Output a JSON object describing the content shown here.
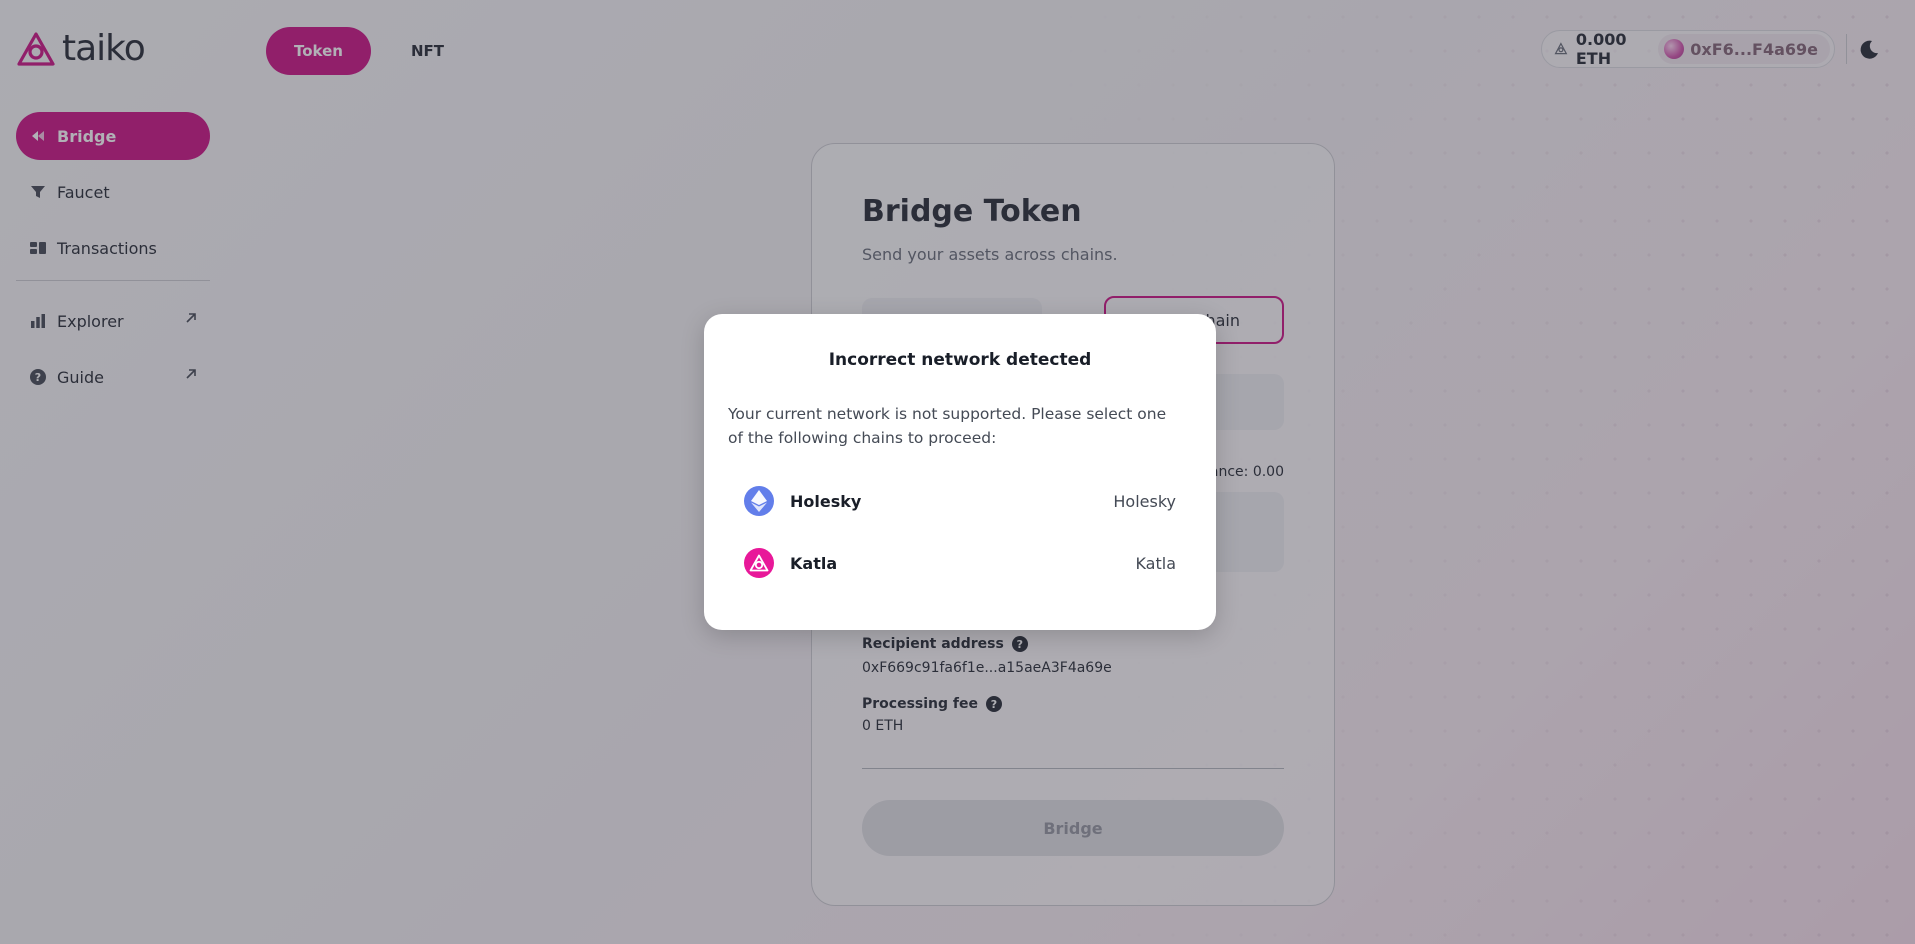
{
  "app": {
    "logo_text": "taiko"
  },
  "top_tabs": [
    {
      "label": "Token",
      "active": true
    },
    {
      "label": "NFT",
      "active": false
    }
  ],
  "sidebar": {
    "items": [
      {
        "label": "Bridge",
        "icon": "bridge-icon",
        "active": true
      },
      {
        "label": "Faucet",
        "icon": "faucet-icon",
        "active": false
      },
      {
        "label": "Transactions",
        "icon": "transactions-icon",
        "active": false
      }
    ],
    "external": [
      {
        "label": "Explorer",
        "icon": "chart-icon"
      },
      {
        "label": "Guide",
        "icon": "question-icon"
      }
    ]
  },
  "wallet": {
    "balance": "0.000 ETH",
    "address": "0xF6...F4a69e"
  },
  "bridge_card": {
    "title": "Bridge Token",
    "subtitle": "Send your assets across chains.",
    "to_chain_visible": "hain",
    "balance_label": "ance: 0.00",
    "recipient_label": "Recipient address",
    "recipient_value": "0xF669c91fa6f1e...a15aeA3F4a69e",
    "fee_label": "Processing fee",
    "fee_value": "0 ETH",
    "bridge_button": "Bridge"
  },
  "modal": {
    "title": "Incorrect network detected",
    "description": "Your current network is not supported. Please select one of the following chains to proceed:",
    "chains": [
      {
        "name": "Holesky",
        "tag": "Holesky",
        "icon": "ethereum-icon",
        "color": "#627eea"
      },
      {
        "name": "Katla",
        "tag": "Katla",
        "icon": "taiko-icon",
        "color": "#e81899"
      }
    ]
  },
  "colors": {
    "accent": "#c8047d",
    "text": "#191e28"
  }
}
